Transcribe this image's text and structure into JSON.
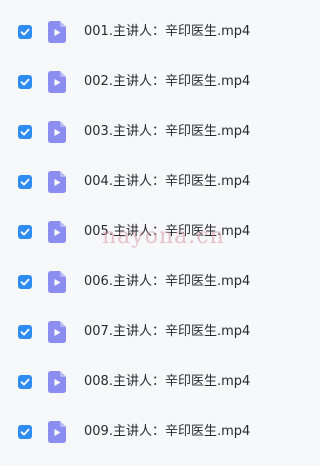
{
  "files": [
    {
      "name": "001.主讲人：辛印医生.mp4",
      "checked": true,
      "icon": "video-file-icon"
    },
    {
      "name": "002.主讲人：辛印医生.mp4",
      "checked": true,
      "icon": "video-file-icon"
    },
    {
      "name": "003.主讲人：辛印医生.mp4",
      "checked": true,
      "icon": "video-file-icon"
    },
    {
      "name": "004.主讲人：辛印医生.mp4",
      "checked": true,
      "icon": "video-file-icon"
    },
    {
      "name": "005.主讲人：辛印医生.mp4",
      "checked": true,
      "icon": "video-file-icon"
    },
    {
      "name": "006.主讲人：辛印医生.mp4",
      "checked": true,
      "icon": "video-file-icon"
    },
    {
      "name": "007.主讲人：辛印医生.mp4",
      "checked": true,
      "icon": "video-file-icon"
    },
    {
      "name": "008.主讲人：辛印医生.mp4",
      "checked": true,
      "icon": "video-file-icon"
    },
    {
      "name": "009.主讲人：辛印医生.mp4",
      "checked": true,
      "icon": "video-file-icon"
    }
  ],
  "watermark": "nayona.cn",
  "colors": {
    "checkbox": "#2f8cf2",
    "file_icon": "#8b8ef0",
    "background": "#f7f8fa"
  }
}
